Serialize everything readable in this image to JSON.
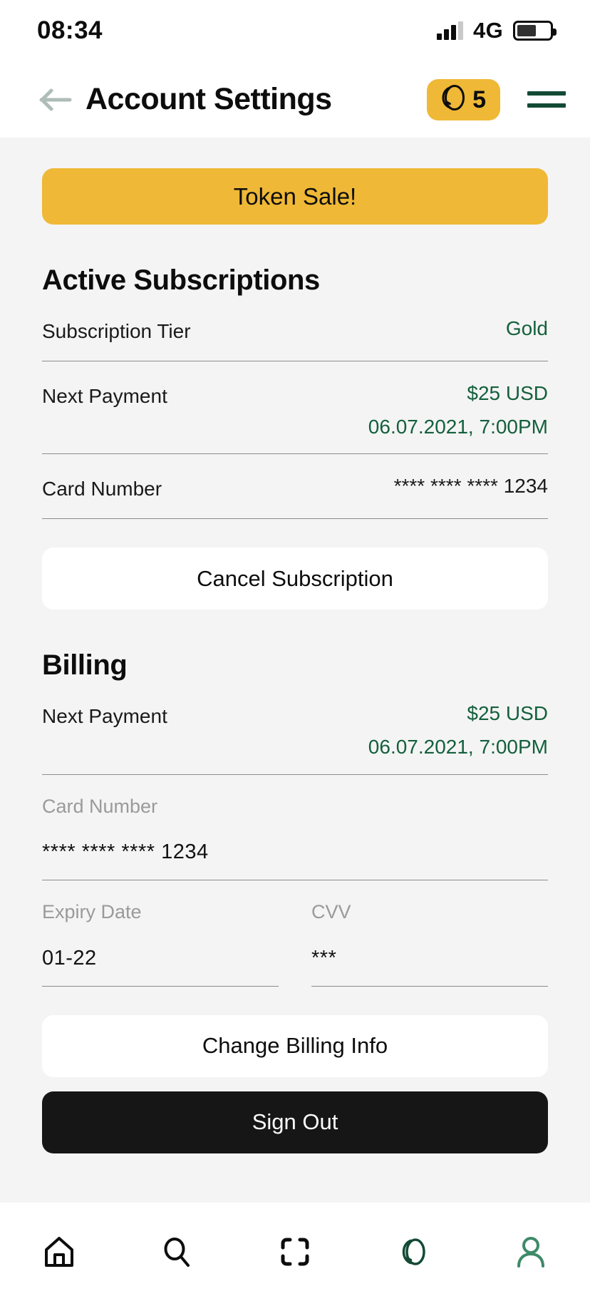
{
  "status_bar": {
    "time": "08:34",
    "network": "4G",
    "signal_icon": "signal-bars-icon",
    "battery_icon": "battery-icon",
    "battery_level": 60
  },
  "header": {
    "back_icon": "arrow-left-icon",
    "title": "Account Settings",
    "token_badge": {
      "icon": "coin-icon",
      "count": "5"
    },
    "menu_icon": "hamburger-menu-icon"
  },
  "promo": {
    "label": "Token Sale!"
  },
  "active_subscriptions": {
    "title": "Active Subscriptions",
    "rows": [
      {
        "label": "Subscription Tier",
        "values": [
          "Gold"
        ],
        "value_color": "green"
      },
      {
        "label": "Next Payment",
        "values": [
          "$25 USD",
          "06.07.2021, 7:00PM"
        ],
        "value_color": "green"
      },
      {
        "label": "Card Number",
        "values": [
          "**** **** **** 1234"
        ],
        "value_color": "dark"
      }
    ],
    "cancel_label": "Cancel Subscription"
  },
  "billing": {
    "title": "Billing",
    "next_payment": {
      "label": "Next Payment",
      "values": [
        "$25 USD",
        "06.07.2021, 7:00PM"
      ]
    },
    "fields": {
      "card_number": {
        "label": "Card Number",
        "value": "**** **** **** 1234"
      },
      "expiry_date": {
        "label": "Expiry Date",
        "value": "01-22"
      },
      "cvv": {
        "label": "CVV",
        "value": "***"
      }
    },
    "change_label": "Change Billing Info",
    "signout_label": "Sign Out"
  },
  "bottom_nav": {
    "items": [
      {
        "name": "home-icon",
        "active": false
      },
      {
        "name": "search-icon",
        "active": false
      },
      {
        "name": "scan-icon",
        "active": false
      },
      {
        "name": "coin-icon",
        "active": false
      },
      {
        "name": "profile-icon",
        "active": true
      }
    ]
  },
  "colors": {
    "accent_yellow": "#EFB836",
    "brand_green": "#14603D",
    "active_green": "#3E8A68",
    "background": "#F4F4F4",
    "dark": "#161616"
  }
}
